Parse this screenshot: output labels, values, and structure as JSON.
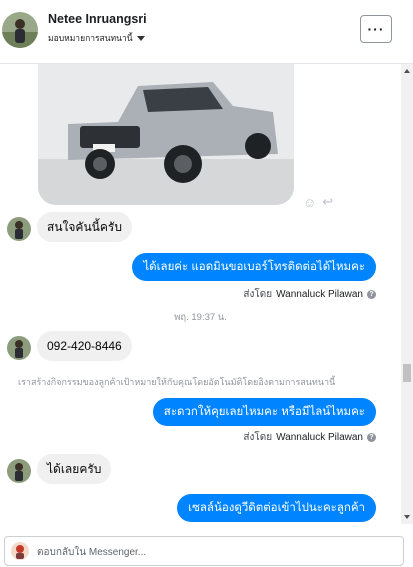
{
  "header": {
    "contact_name": "Netee Inruangsri",
    "assign_label": "มอบหมายการสนทนานี้",
    "more_label": "···"
  },
  "messages": {
    "m1": "สนใจคันนี้ครับ",
    "m2": "ได้เลยค่ะ แอดมินขอเบอร์โทรติดต่อได้ไหมคะ",
    "m3": "092-420-8446",
    "m4": "สะดวกให้คุยเลยไหมคะ หรือมีไลน์ไหมคะ",
    "m5": "ได้เลยครับ",
    "m6": "เซลล์น้องดูวีดิตต่อเข้าไปนะคะลูกค้า"
  },
  "sent_by": {
    "label": "ส่งโดย",
    "name": "Wannaluck Pilawan",
    "help": "?"
  },
  "timestamp": "พฤ. 19:37 น.",
  "system_note": "เราสร้างกิจกรรมของลูกค้าเป้าหมายให้กับคุณโดยอัตโนมัติโดยอิงตามการสนทนานี้",
  "composer": {
    "placeholder": "ตอบกลับใน Messenger..."
  },
  "icons": {
    "smiley": "☺",
    "reply": "↩"
  },
  "colors": {
    "outgoing_bubble": "#0084ff",
    "incoming_bubble": "#f1f0f0",
    "meta_text": "#90949c"
  }
}
